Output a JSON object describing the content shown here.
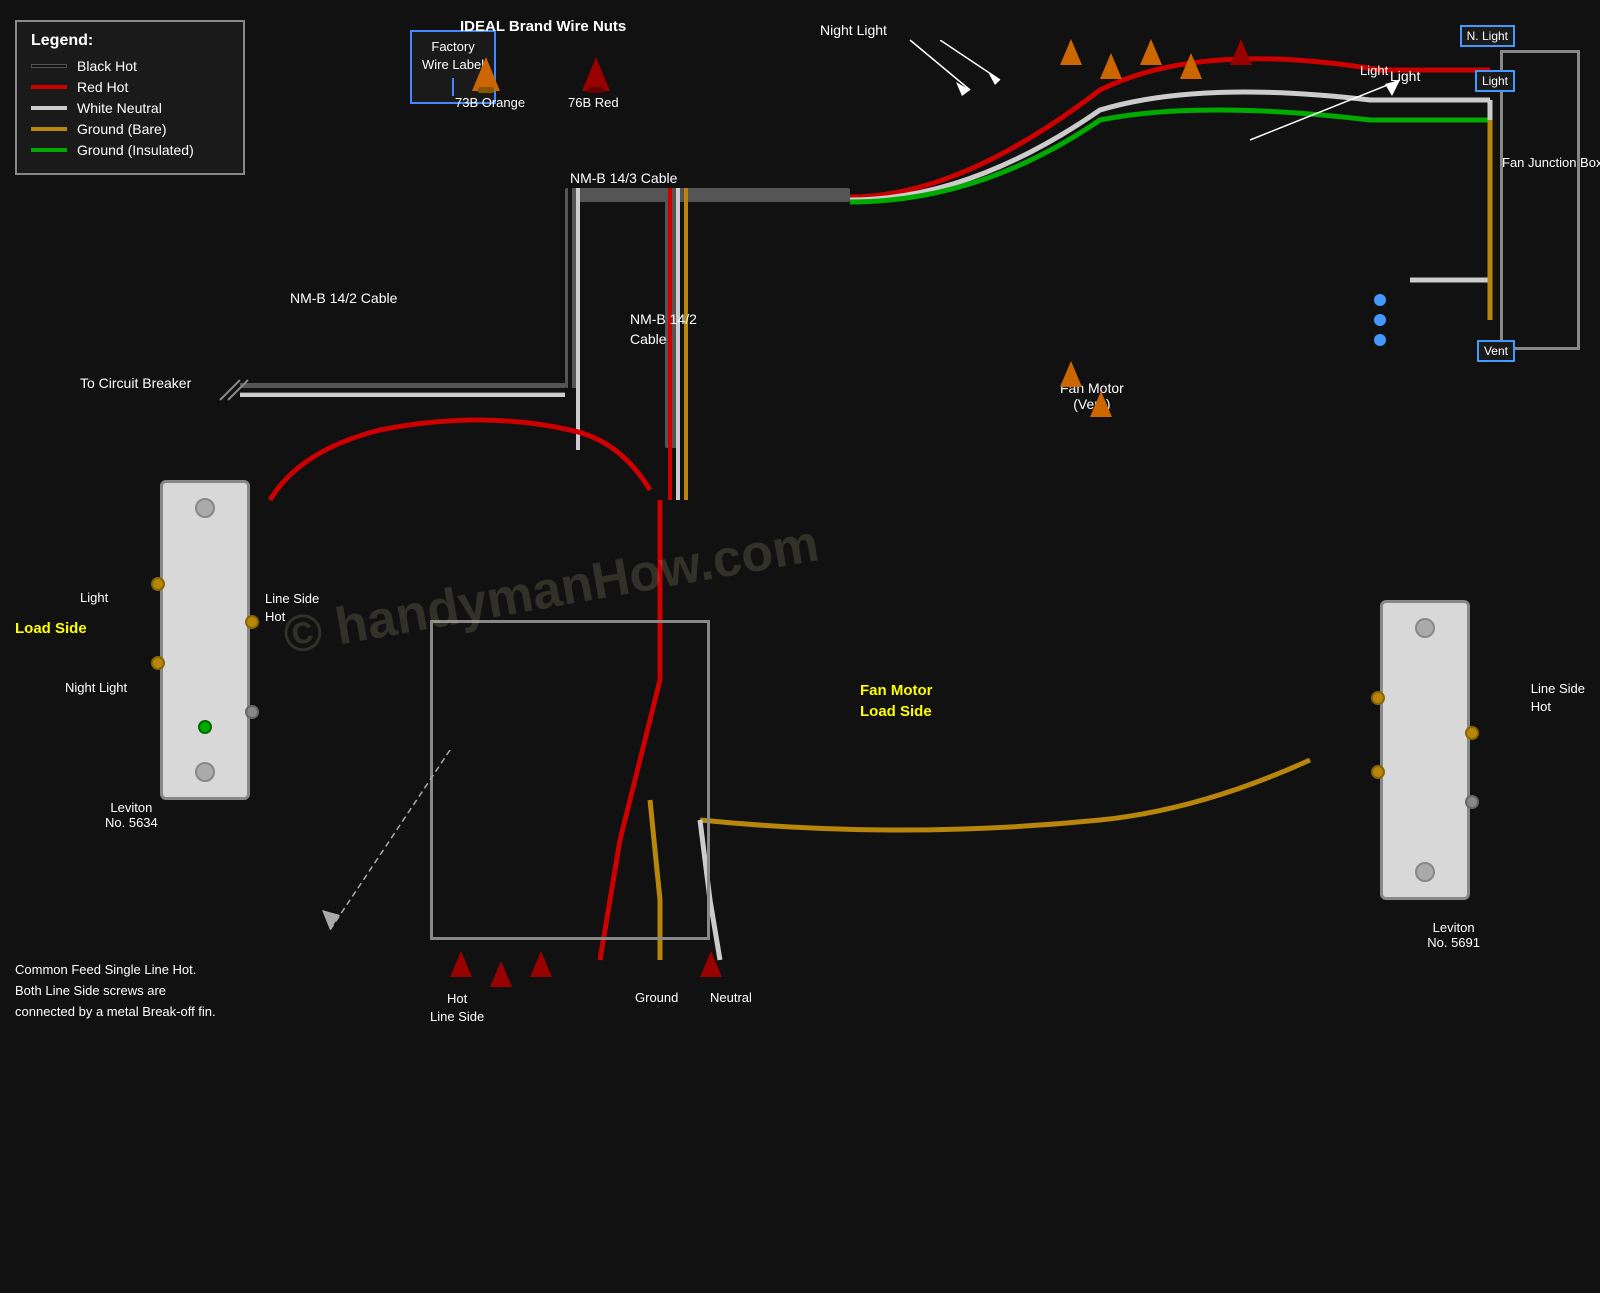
{
  "legend": {
    "title": "Legend:",
    "items": [
      {
        "label": "Black Hot",
        "color": "#111111",
        "stroke": "#000000"
      },
      {
        "label": "Red Hot",
        "color": "#cc0000",
        "stroke": "#cc0000"
      },
      {
        "label": "White Neutral",
        "color": "#cccccc",
        "stroke": "#cccccc"
      },
      {
        "label": "Ground (Bare)",
        "color": "#aa7700",
        "stroke": "#aa7700"
      },
      {
        "label": "Ground (Insulated)",
        "color": "#00aa00",
        "stroke": "#00aa00"
      }
    ]
  },
  "factory_label": "Factory\nWire Label",
  "ideal_brand": {
    "title": "IDEAL Brand Wire Nuts",
    "nut1": "73B Orange",
    "nut2": "76B Red"
  },
  "cable_labels": {
    "nmb_143": "NM-B 14/3 Cable",
    "nmb_142_top": "NM-B 14/2 Cable",
    "nmb_142_mid": "NM-B 14/2\nCable"
  },
  "annotations": {
    "circuit_breaker": "To Circuit Breaker",
    "fan_junction": "Fan Junction Box",
    "night_light_top": "Night Light",
    "light_top": "Light",
    "fan_motor": "Fan Motor\n(Vent)",
    "load_side_left": "Load Side",
    "line_side_hot_left": "Line Side\nHot",
    "load_side_right": "Fan Motor\nLoad Side",
    "line_side_hot_right": "Line Side\nHot",
    "light_left": "Light",
    "night_light_left": "Night Light",
    "hot_line_side": "Hot\nLine Side",
    "ground_bot": "Ground",
    "neutral_bot": "Neutral",
    "leviton_left": "Leviton\nNo. 5634",
    "leviton_right": "Leviton\nNo. 5691",
    "common_feed": "Common Feed Single Line Hot.\nBoth Line Side screws are\nconnected by a metal Break-off fin.",
    "tags": {
      "n_light": "N. Light",
      "light1": "Light",
      "vent": "Vent"
    }
  },
  "colors": {
    "black": "#111111",
    "red": "#cc0000",
    "white": "#cccccc",
    "ground_bare": "#b8860b",
    "ground_green": "#00aa00",
    "wire_nut_orange": "#cc6600",
    "wire_nut_red": "#990000",
    "accent_blue": "#4499ff",
    "yellow_label": "#ffff00"
  }
}
